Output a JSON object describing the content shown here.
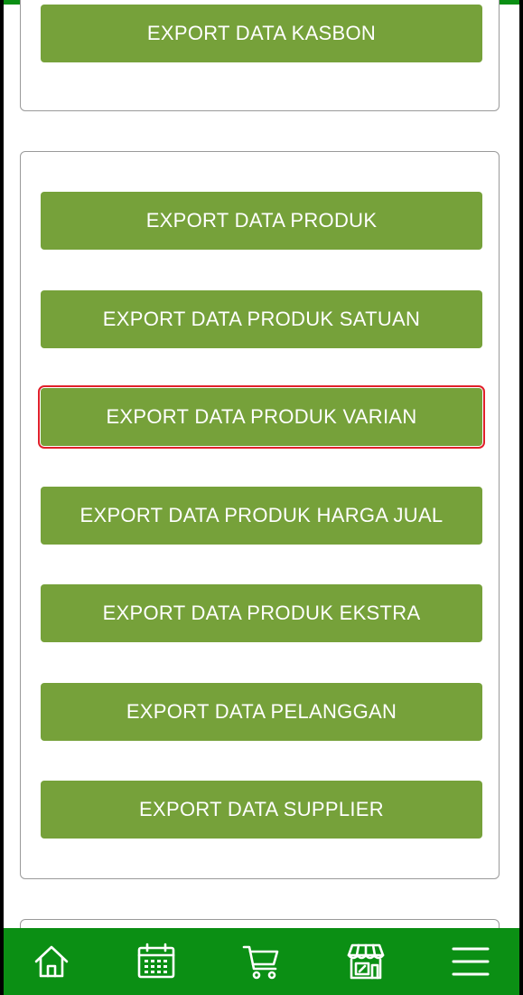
{
  "kasbon_section": {
    "export_kasbon_label": "EXPORT DATA KASBON"
  },
  "produk_section": {
    "buttons": [
      {
        "label": "EXPORT DATA PRODUK"
      },
      {
        "label": "EXPORT DATA PRODUK SATUAN"
      },
      {
        "label": "EXPORT DATA PRODUK VARIAN",
        "highlighted": true
      },
      {
        "label": "EXPORT DATA PRODUK HARGA JUAL"
      },
      {
        "label": "EXPORT DATA PRODUK EKSTRA"
      },
      {
        "label": "EXPORT DATA PELANGGAN"
      },
      {
        "label": "EXPORT DATA SUPPLIER"
      }
    ]
  },
  "bottom_nav": {
    "items": [
      {
        "icon": "home-icon"
      },
      {
        "icon": "calendar-icon"
      },
      {
        "icon": "cart-icon"
      },
      {
        "icon": "store-icon"
      },
      {
        "icon": "menu-icon"
      }
    ]
  },
  "colors": {
    "button_green": "#76a13a",
    "nav_green": "#0b8f14",
    "highlight_red": "#e0202a",
    "card_border": "#9a9a9a"
  }
}
